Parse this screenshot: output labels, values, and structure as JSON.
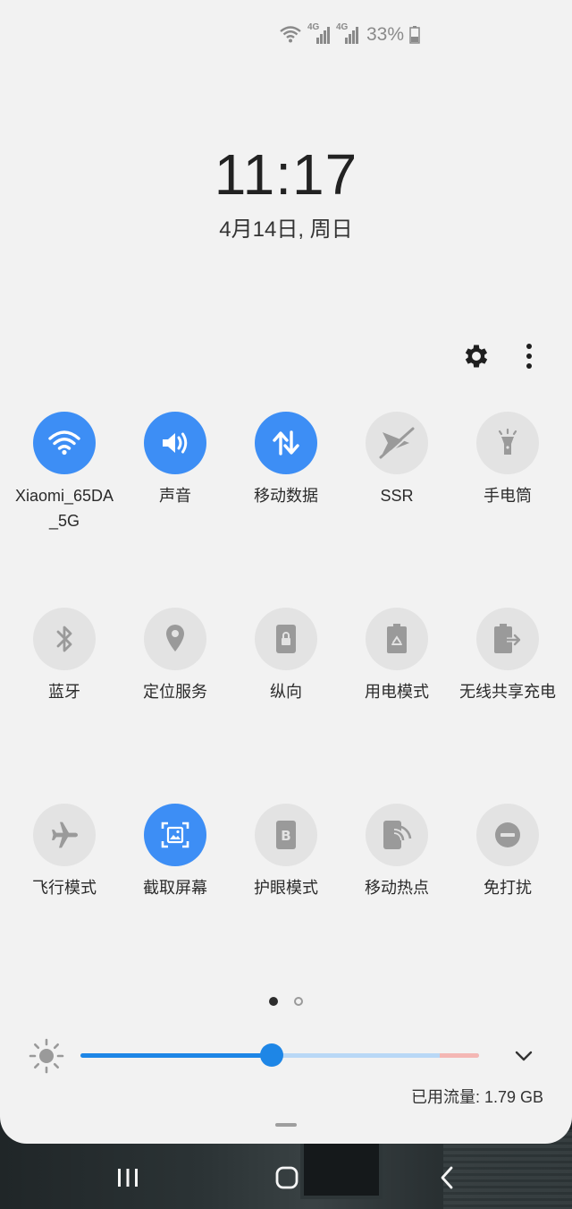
{
  "status_bar": {
    "battery_percent": "33%",
    "network_1": "4G",
    "network_2": "4G"
  },
  "clock": {
    "time": "11:17",
    "date": "4月14日, 周日"
  },
  "header": {
    "settings_icon": "gear-icon",
    "more_icon": "more-vertical-icon"
  },
  "tiles": [
    {
      "label": "Xiaomi_65DA_5G",
      "icon": "wifi-icon",
      "on": true
    },
    {
      "label": "声音",
      "icon": "volume-icon",
      "on": true
    },
    {
      "label": "移动数据",
      "icon": "mobile-data-icon",
      "on": true
    },
    {
      "label": "SSR",
      "icon": "paper-plane-off-icon",
      "on": false
    },
    {
      "label": "手电筒",
      "icon": "flashlight-icon",
      "on": false
    },
    {
      "label": "蓝牙",
      "icon": "bluetooth-icon",
      "on": false
    },
    {
      "label": "定位服务",
      "icon": "location-icon",
      "on": false
    },
    {
      "label": "纵向",
      "icon": "portrait-lock-icon",
      "on": false
    },
    {
      "label": "用电模式",
      "icon": "power-mode-icon",
      "on": false
    },
    {
      "label": "无线共享充电",
      "icon": "wireless-share-icon",
      "on": false
    },
    {
      "label": "飞行模式",
      "icon": "airplane-icon",
      "on": false
    },
    {
      "label": "截取屏幕",
      "icon": "screenshot-icon",
      "on": true
    },
    {
      "label": "护眼模式",
      "icon": "eye-comfort-icon",
      "on": false
    },
    {
      "label": "移动热点",
      "icon": "hotspot-icon",
      "on": false
    },
    {
      "label": "免打扰",
      "icon": "do-not-disturb-icon",
      "on": false
    }
  ],
  "pagination": {
    "current": 1,
    "total": 2
  },
  "brightness": {
    "level": 0.48,
    "icon": "sun-icon",
    "expand_icon": "chevron-down-icon"
  },
  "data_usage": {
    "text": "已用流量: 1.79 GB"
  },
  "nav": {
    "recents_icon": "recents-icon",
    "home_icon": "home-icon",
    "back_icon": "back-icon"
  },
  "colors": {
    "accent": "#3d8ef5",
    "panel": "#f2f2f2",
    "tile_off": "#e3e3e3"
  }
}
